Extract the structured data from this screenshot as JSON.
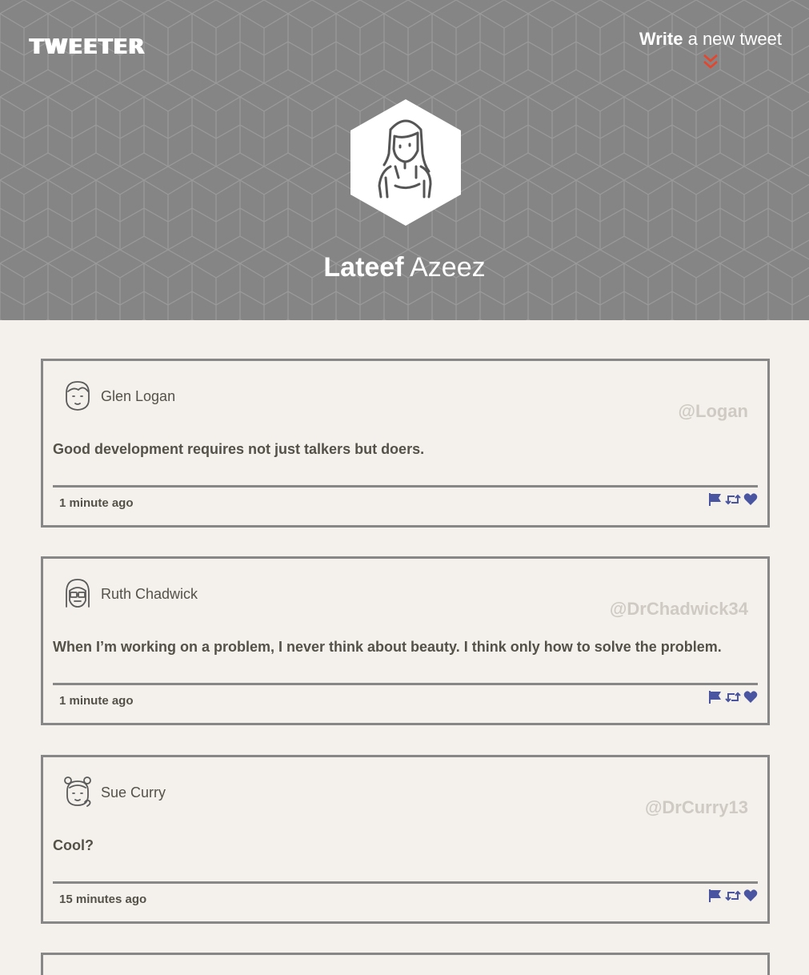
{
  "header": {
    "logo": "TWEETER",
    "compose_bold": "Write",
    "compose_rest": " a new tweet",
    "user_first": "Lateef",
    "user_last": " Azeez"
  },
  "colors": {
    "header_bg": "#858585",
    "page_bg": "#f4f1ec",
    "action_icons": "#4a55a2",
    "chevron": "#e8442c",
    "handle": "#cfcac3"
  },
  "tweets": [
    {
      "name": "Glen Logan",
      "handle": "@Logan",
      "text": "Good development requires not just talkers but doers.",
      "time": "1 minute ago",
      "avatar_icon": "male-avatar-icon"
    },
    {
      "name": "Ruth Chadwick",
      "handle": "@DrChadwick34",
      "text": "When I’m working on a problem, I never think about beauty. I think only how to solve the problem.",
      "time": "1 minute ago",
      "avatar_icon": "glasses-avatar-icon"
    },
    {
      "name": "Sue Curry",
      "handle": "@DrCurry13",
      "text": "Cool?",
      "time": "15 minutes ago",
      "avatar_icon": "bun-hair-avatar-icon"
    }
  ]
}
